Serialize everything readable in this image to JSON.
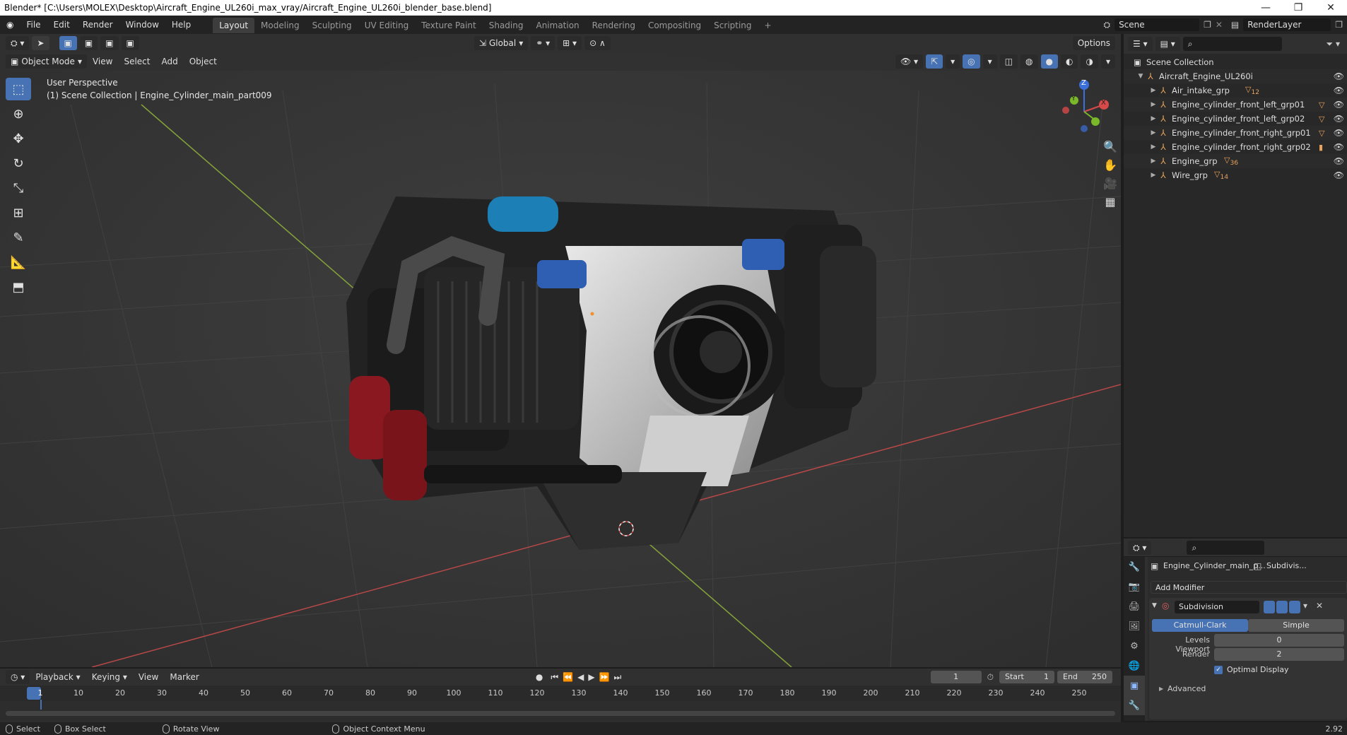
{
  "window": {
    "title": "Blender* [C:\\Users\\MOLEX\\Desktop\\Aircraft_Engine_UL260i_max_vray/Aircraft_Engine_UL260i_blender_base.blend]"
  },
  "menus": [
    "File",
    "Edit",
    "Render",
    "Window",
    "Help"
  ],
  "workspaces": [
    "Layout",
    "Modeling",
    "Sculpting",
    "UV Editing",
    "Texture Paint",
    "Shading",
    "Animation",
    "Rendering",
    "Compositing",
    "Scripting"
  ],
  "scene": {
    "name": "Scene",
    "render_layer": "RenderLayer"
  },
  "viewport": {
    "transform_orientation": "Global",
    "options_label": "Options",
    "mode": "Object Mode",
    "menus": [
      "View",
      "Select",
      "Add",
      "Object"
    ],
    "perspective_label": "User Perspective",
    "collection_label": "(1) Scene Collection | Engine_Cylinder_main_part009",
    "gizmo": {
      "z": "Z",
      "y": "Y",
      "x": "X"
    }
  },
  "outliner": {
    "root": "Scene Collection",
    "collection": "Aircraft_Engine_UL260i",
    "items": [
      {
        "name": "Air_intake_grp",
        "badge": "12"
      },
      {
        "name": "Engine_cylinder_front_left_grp01",
        "badge": ""
      },
      {
        "name": "Engine_cylinder_front_left_grp02",
        "badge": ""
      },
      {
        "name": "Engine_cylinder_front_right_grp01",
        "badge": ""
      },
      {
        "name": "Engine_cylinder_front_right_grp02",
        "badge": ""
      },
      {
        "name": "Engine_grp",
        "badge": "36"
      },
      {
        "name": "Wire_grp",
        "badge": "14"
      }
    ]
  },
  "properties": {
    "object_name": "Engine_Cylinder_main_p...",
    "modifier_short": "Subdivis...",
    "add_modifier": "Add Modifier",
    "modifier_name": "Subdivision",
    "mode_catmull": "Catmull-Clark",
    "mode_simple": "Simple",
    "levels_viewport_label": "Levels Viewport",
    "levels_viewport_value": "0",
    "render_label": "Render",
    "render_value": "2",
    "optimal_display": "Optimal Display",
    "advanced": "Advanced"
  },
  "timeline": {
    "menus": [
      "Playback",
      "Keying",
      "View",
      "Marker"
    ],
    "current_frame": "1",
    "start_label": "Start",
    "start_value": "1",
    "end_label": "End",
    "end_value": "250",
    "ticks": [
      "1",
      "10",
      "20",
      "30",
      "40",
      "50",
      "60",
      "70",
      "80",
      "90",
      "100",
      "110",
      "120",
      "130",
      "140",
      "150",
      "160",
      "170",
      "180",
      "190",
      "200",
      "210",
      "220",
      "230",
      "240",
      "250"
    ]
  },
  "status": {
    "select": "Select",
    "box_select": "Box Select",
    "rotate_view": "Rotate View",
    "context_menu": "Object Context Menu",
    "version": "2.92"
  },
  "colors": {
    "accent": "#4772b3",
    "engine_red": "#8a1820",
    "grid_x": "#c04040",
    "grid_y": "#8aa83a"
  }
}
